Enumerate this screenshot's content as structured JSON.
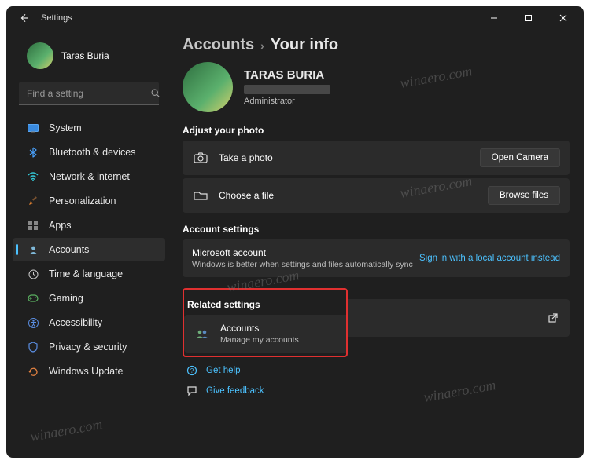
{
  "window": {
    "title": "Settings"
  },
  "user": {
    "name": "Taras Buria"
  },
  "search": {
    "placeholder": "Find a setting"
  },
  "sidebar": {
    "items": [
      {
        "label": "System"
      },
      {
        "label": "Bluetooth & devices"
      },
      {
        "label": "Network & internet"
      },
      {
        "label": "Personalization"
      },
      {
        "label": "Apps"
      },
      {
        "label": "Accounts"
      },
      {
        "label": "Time & language"
      },
      {
        "label": "Gaming"
      },
      {
        "label": "Accessibility"
      },
      {
        "label": "Privacy & security"
      },
      {
        "label": "Windows Update"
      }
    ]
  },
  "breadcrumb": {
    "root": "Accounts",
    "page": "Your info"
  },
  "profile": {
    "display_name": "TARAS BURIA",
    "role": "Administrator"
  },
  "sections": {
    "adjust_photo": {
      "title": "Adjust your photo",
      "take_photo_label": "Take a photo",
      "open_camera_label": "Open Camera",
      "choose_file_label": "Choose a file",
      "browse_files_label": "Browse files"
    },
    "account_settings": {
      "title": "Account settings",
      "ms_account_title": "Microsoft account",
      "ms_account_sub": "Windows is better when settings and files automatically sync",
      "local_link": "Sign in with a local account instead"
    },
    "related": {
      "title": "Related settings",
      "accounts_title": "Accounts",
      "accounts_sub": "Manage my accounts"
    },
    "help": {
      "get_help": "Get help",
      "feedback": "Give feedback"
    }
  },
  "watermark": "winaero.com"
}
